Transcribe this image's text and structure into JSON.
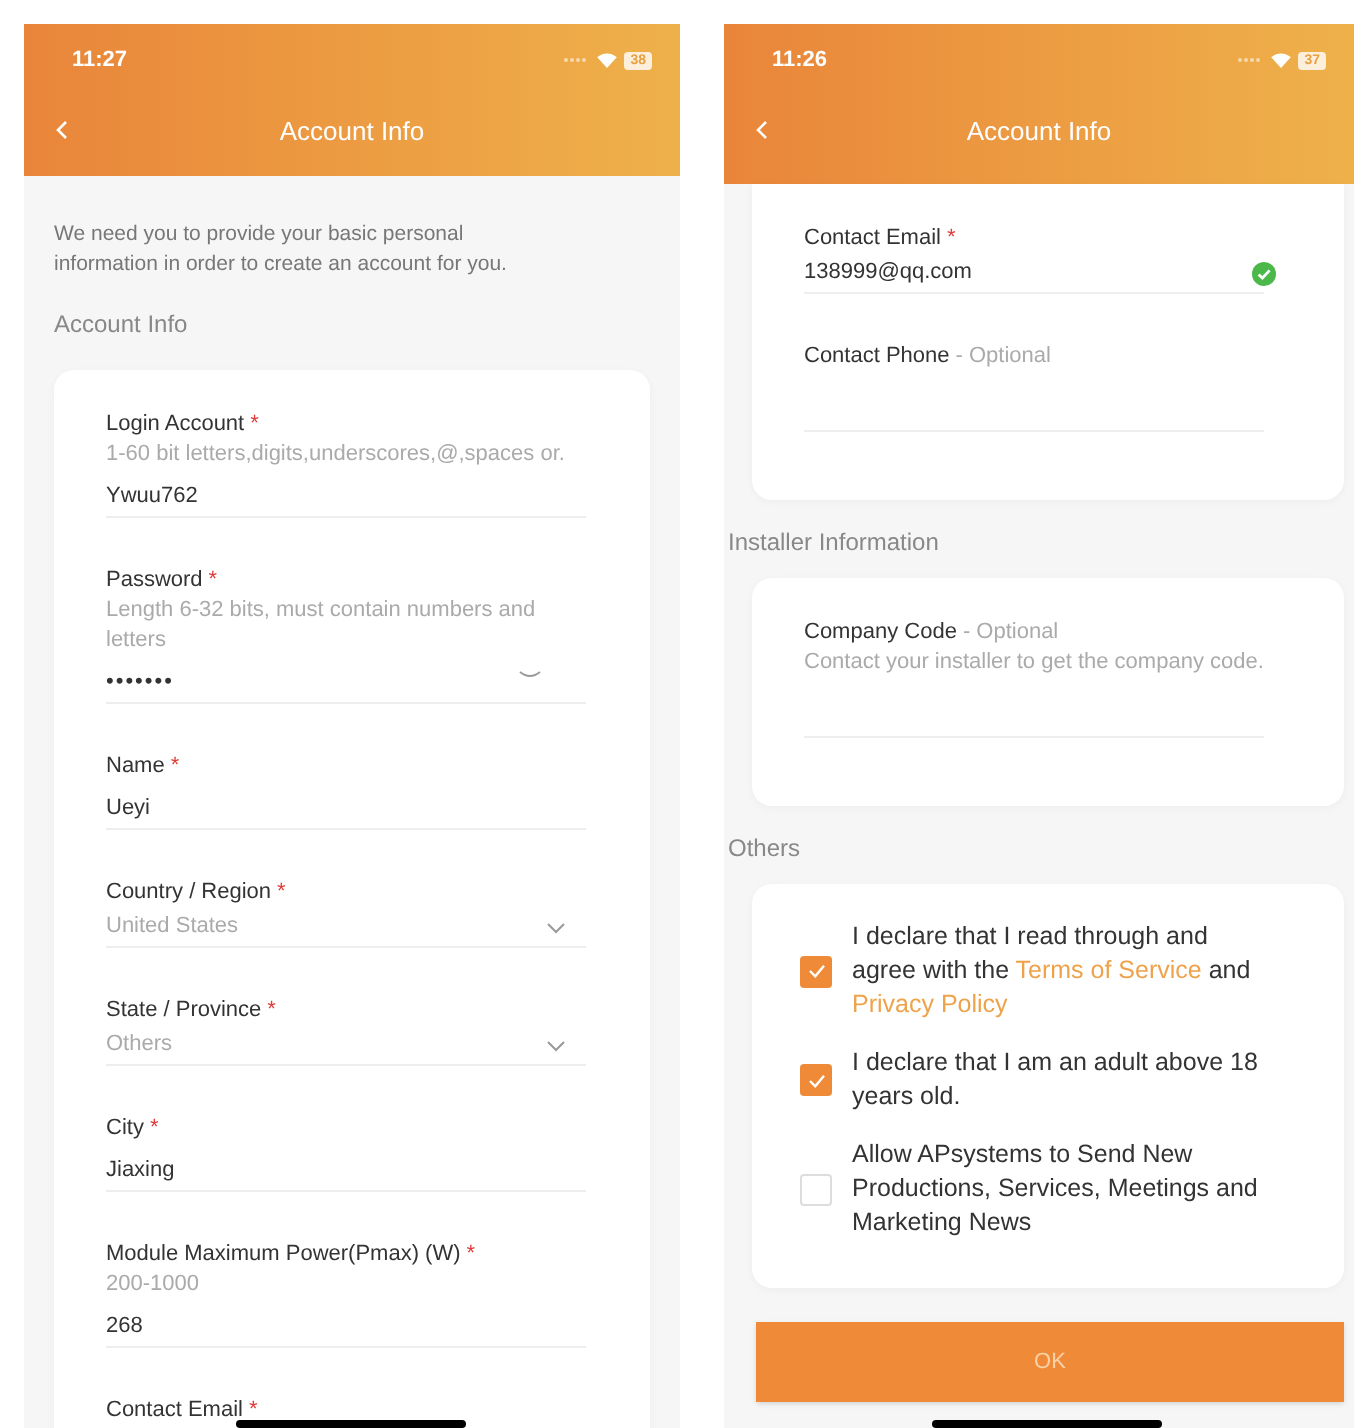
{
  "screens": [
    {
      "status_bar": {
        "time": "11:27",
        "battery": "38"
      },
      "header": {
        "title": "Account Info"
      },
      "intro": "We need you to provide your basic personal information in order to create an account for you.",
      "sections": [
        {
          "heading": "Account Info",
          "cut_top": false,
          "fields": [
            {
              "kind": "text",
              "label": "Login Account",
              "marker": "*",
              "hint": "1-60 bit letters,digits,underscores,@,spaces or.",
              "value": "Ywuu762"
            },
            {
              "kind": "password",
              "label": "Password",
              "marker": "*",
              "hint": "Length 6-32 bits, must contain numbers and letters",
              "value": "•••••••"
            },
            {
              "kind": "text",
              "label": "Name",
              "marker": "*",
              "value": "Ueyi"
            },
            {
              "kind": "select",
              "label": "Country / Region",
              "marker": "*",
              "value": "United States"
            },
            {
              "kind": "select",
              "label": "State / Province",
              "marker": "*",
              "value": "Others"
            },
            {
              "kind": "text",
              "label": "City",
              "marker": "*",
              "value": "Jiaxing"
            },
            {
              "kind": "text",
              "label": "Module Maximum Power(Pmax) (W)",
              "marker": "*",
              "hint": "200-1000",
              "value": "268"
            },
            {
              "kind": "label_only",
              "label": "Contact Email",
              "marker": "*"
            }
          ]
        }
      ]
    },
    {
      "status_bar": {
        "time": "11:26",
        "battery": "37"
      },
      "header": {
        "title": "Account Info"
      },
      "sections": [
        {
          "cut_top": true,
          "fields": [
            {
              "kind": "email",
              "label": "Contact Email",
              "marker": "*",
              "value": "138999@qq.com",
              "valid": true
            },
            {
              "kind": "text",
              "label": "Contact Phone",
              "note": "- Optional"
            }
          ]
        },
        {
          "heading": "Installer Information",
          "cut_top": false,
          "fields": [
            {
              "kind": "text",
              "label": "Company Code",
              "note": "- Optional",
              "hint": "Contact your installer to get the company code."
            }
          ]
        },
        {
          "heading": "Others",
          "cut_top": false,
          "checks": [
            {
              "checked": true,
              "parts": [
                {
                  "text": "I declare that I read through and agree with the "
                },
                {
                  "text": "Terms of Service",
                  "link": true
                },
                {
                  "text": " and "
                },
                {
                  "text": "Privacy Policy",
                  "link": true
                }
              ]
            },
            {
              "checked": true,
              "parts": [
                {
                  "text": "I declare that I am an adult above 18 years old."
                }
              ]
            },
            {
              "checked": false,
              "parts": [
                {
                  "text": "Allow APsystems to Send New Productions, Services, Meetings and Marketing News"
                }
              ]
            }
          ]
        }
      ],
      "button": {
        "label": "OK"
      }
    }
  ]
}
